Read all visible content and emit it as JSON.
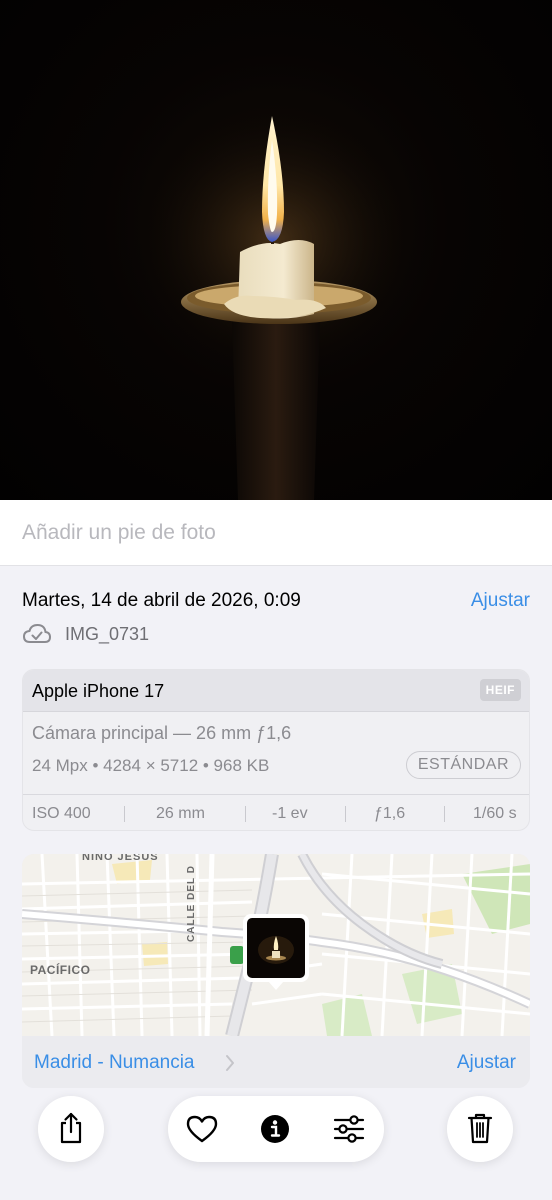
{
  "caption": {
    "placeholder": "Añadir un pie de foto"
  },
  "info": {
    "date": "Martes, 14 de abril de 2026, 0:09",
    "adjust_label": "Ajustar",
    "filename": "IMG_0731",
    "cloud_icon": "icloud-check-icon"
  },
  "camera": {
    "device": "Apple iPhone 17",
    "format": "HEIF",
    "lens": "Cámara principal — 26 mm ƒ1,6",
    "specs": "24 Mpx • 4284 × 5712 • 968 KB",
    "profile": "ESTÁNDAR",
    "exif": [
      "ISO 400",
      "26 mm",
      "-1 ev",
      "ƒ1,6",
      "1/60 s"
    ]
  },
  "map": {
    "labels": [
      "NIÑO JESÚS",
      "CALLE DEL D",
      "PACÍFICO"
    ],
    "location": "Madrid - Numancia",
    "adjust_label": "Ajustar"
  },
  "toolbar": {
    "icons": [
      "share-icon",
      "heart-icon",
      "info-icon",
      "adjust-sliders-icon",
      "trash-icon"
    ]
  },
  "colors": {
    "accent": "#3a8ee6",
    "background": "#f2f2f7",
    "secondary_text": "#8b8b90"
  }
}
